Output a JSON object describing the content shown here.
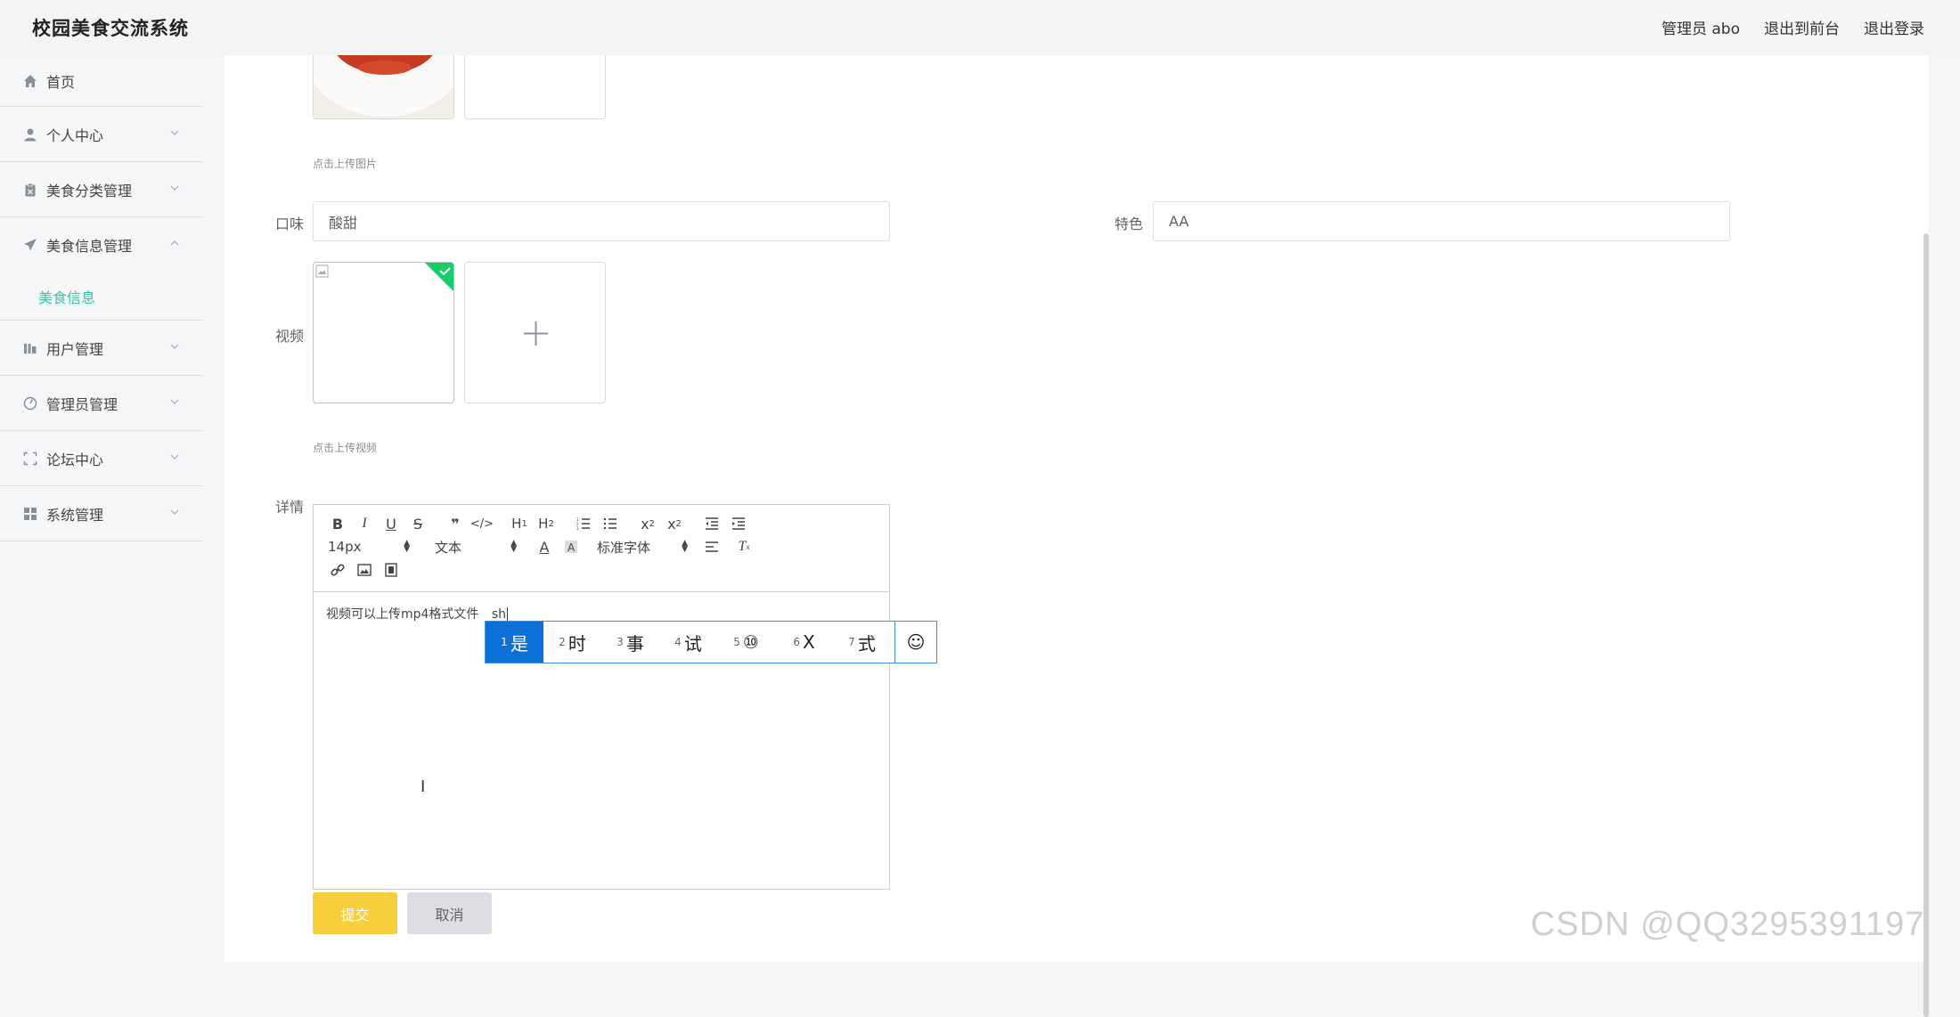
{
  "header": {
    "title": "校园美食交流系统",
    "user": "管理员 abo",
    "to_front": "退出到前台",
    "logout": "退出登录"
  },
  "sidebar": {
    "items": [
      {
        "label": "首页",
        "icon": "home-icon"
      },
      {
        "label": "个人中心",
        "icon": "user-icon"
      },
      {
        "label": "美食分类管理",
        "icon": "clipboard-icon"
      },
      {
        "label": "美食信息管理",
        "icon": "send-icon"
      },
      {
        "label": "用户管理",
        "icon": "chart-icon"
      },
      {
        "label": "管理员管理",
        "icon": "gauge-icon"
      },
      {
        "label": "论坛中心",
        "icon": "fullscreen-icon"
      },
      {
        "label": "系统管理",
        "icon": "grid-icon"
      }
    ],
    "active_sub": "美食信息"
  },
  "form": {
    "image_hint": "点击上传图片",
    "taste_label": "口味",
    "taste_value": "酸甜",
    "feature_label": "特色",
    "feature_value": "AA",
    "video_label": "视频",
    "video_hint": "点击上传视频",
    "detail_label": "详情"
  },
  "editor": {
    "font_size": "14px",
    "block_type": "文本",
    "font_family": "标准字体",
    "content": "视频可以上传mp4格式文件",
    "composing": "sh"
  },
  "ime": {
    "candidates": [
      {
        "num": "1",
        "text": "是"
      },
      {
        "num": "2",
        "text": "时"
      },
      {
        "num": "3",
        "text": "事"
      },
      {
        "num": "4",
        "text": "试"
      },
      {
        "num": "5",
        "text": "⑩"
      },
      {
        "num": "6",
        "text": "X"
      },
      {
        "num": "7",
        "text": "式"
      }
    ],
    "emoji": "☺"
  },
  "buttons": {
    "submit": "提交",
    "cancel": "取消"
  },
  "watermark": "CSDN @QQ3295391197",
  "colors": {
    "accent": "#3cc3a8",
    "submit": "#f7ce3b",
    "ime_selected": "#0a6fd6",
    "upload_success": "#13ce66"
  }
}
